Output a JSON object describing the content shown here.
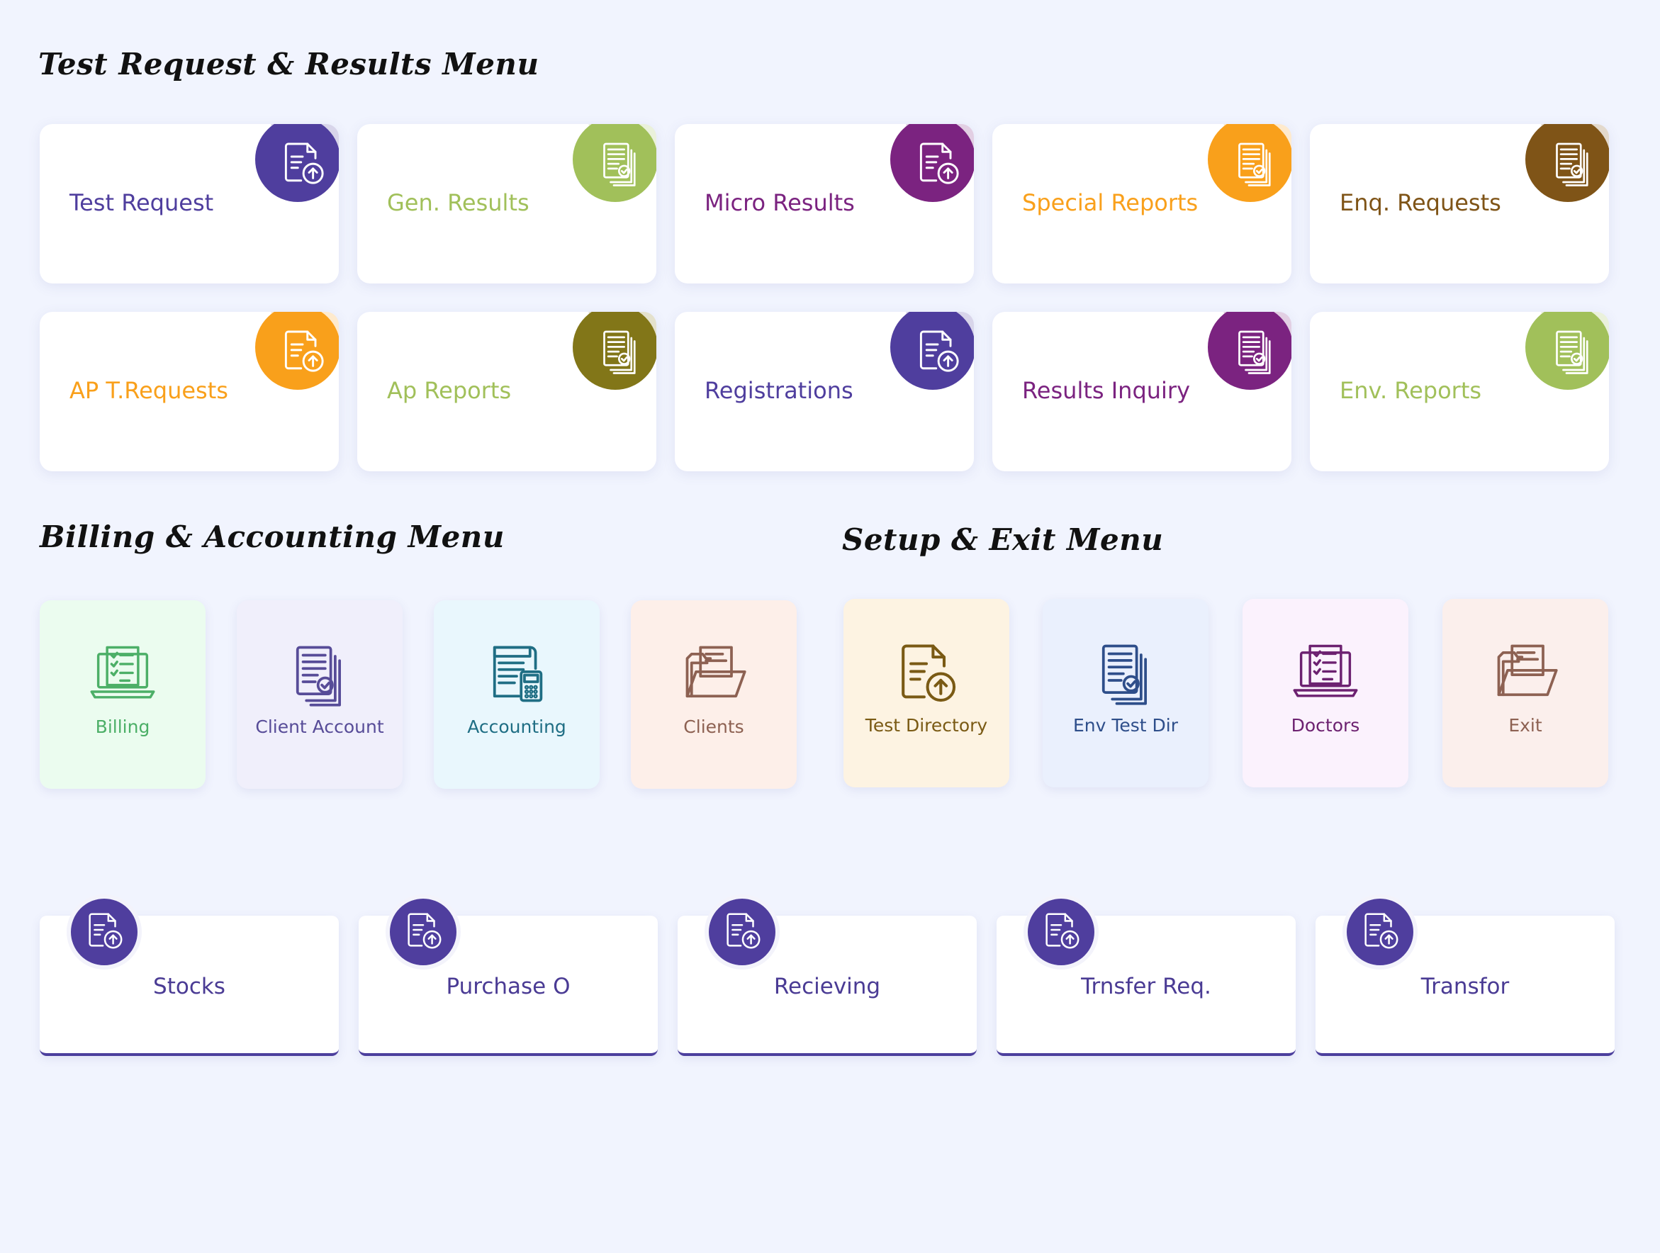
{
  "sections": {
    "test_menu_title": "Test Request & Results Menu",
    "billing_menu_title": "Billing & Accounting Menu",
    "setup_menu_title": "Setup & Exit Menu"
  },
  "test_cards": [
    {
      "label": "Test Request",
      "icon": "document-upload-icon",
      "color": "#4f3e9e",
      "text_color": "#4f3e9e"
    },
    {
      "label": "Gen. Results",
      "icon": "documents-check-icon",
      "color": "#a1c05a",
      "text_color": "#a1c05a"
    },
    {
      "label": "Micro Results",
      "icon": "document-upload-icon",
      "color": "#7b2380",
      "text_color": "#7b2380"
    },
    {
      "label": "Special Reports",
      "icon": "documents-check-icon",
      "color": "#f9a01b",
      "text_color": "#f9a01b"
    },
    {
      "label": "Enq. Requests",
      "icon": "documents-check-icon",
      "color": "#7f5417",
      "text_color": "#7f5417"
    },
    {
      "label": "AP T.Requests",
      "icon": "document-upload-icon",
      "color": "#f9a01b",
      "text_color": "#f9a01b"
    },
    {
      "label": "Ap Reports",
      "icon": "documents-check-icon",
      "color": "#827618",
      "text_color": "#a1c05a"
    },
    {
      "label": "Registrations",
      "icon": "document-upload-icon",
      "color": "#4f3e9e",
      "text_color": "#4f3e9e"
    },
    {
      "label": "Results Inquiry",
      "icon": "documents-check-icon",
      "color": "#7b2380",
      "text_color": "#7b2380"
    },
    {
      "label": "Env. Reports",
      "icon": "documents-check-icon",
      "color": "#a1c05a",
      "text_color": "#a1c05a"
    }
  ],
  "billing_tiles": [
    {
      "label": "Billing",
      "icon": "laptop-checklist-icon",
      "bg": "#ebfcef",
      "color": "#4caf67"
    },
    {
      "label": "Client Account",
      "icon": "documents-check-icon",
      "bg": "#f0effb",
      "color": "#574c98"
    },
    {
      "label": "Accounting",
      "icon": "invoice-calculator-icon",
      "bg": "#e9f7fd",
      "color": "#1f6e84"
    },
    {
      "label": "Clients",
      "icon": "open-folder-icon",
      "bg": "#fdefe9",
      "color": "#8d6152"
    }
  ],
  "setup_tiles": [
    {
      "label": "Test Directory",
      "icon": "document-upload-icon",
      "bg": "#fdf3e2",
      "color": "#7a5a14"
    },
    {
      "label": "Env Test Dir",
      "icon": "documents-check-icon",
      "bg": "#eaf0fd",
      "color": "#2e4e8a"
    },
    {
      "label": "Doctors",
      "icon": "laptop-checklist-icon",
      "bg": "#fbf2fd",
      "color": "#6c2170"
    },
    {
      "label": "Exit",
      "icon": "open-folder-icon",
      "bg": "#fbefec",
      "color": "#8d6152"
    }
  ],
  "inventory_cards": [
    {
      "label": "Stocks",
      "icon": "document-upload-icon"
    },
    {
      "label": "Purchase O",
      "icon": "document-upload-icon"
    },
    {
      "label": "Recieving",
      "icon": "document-upload-icon"
    },
    {
      "label": "Trnsfer Req.",
      "icon": "document-upload-icon"
    },
    {
      "label": "Transfor",
      "icon": "document-upload-icon"
    }
  ]
}
